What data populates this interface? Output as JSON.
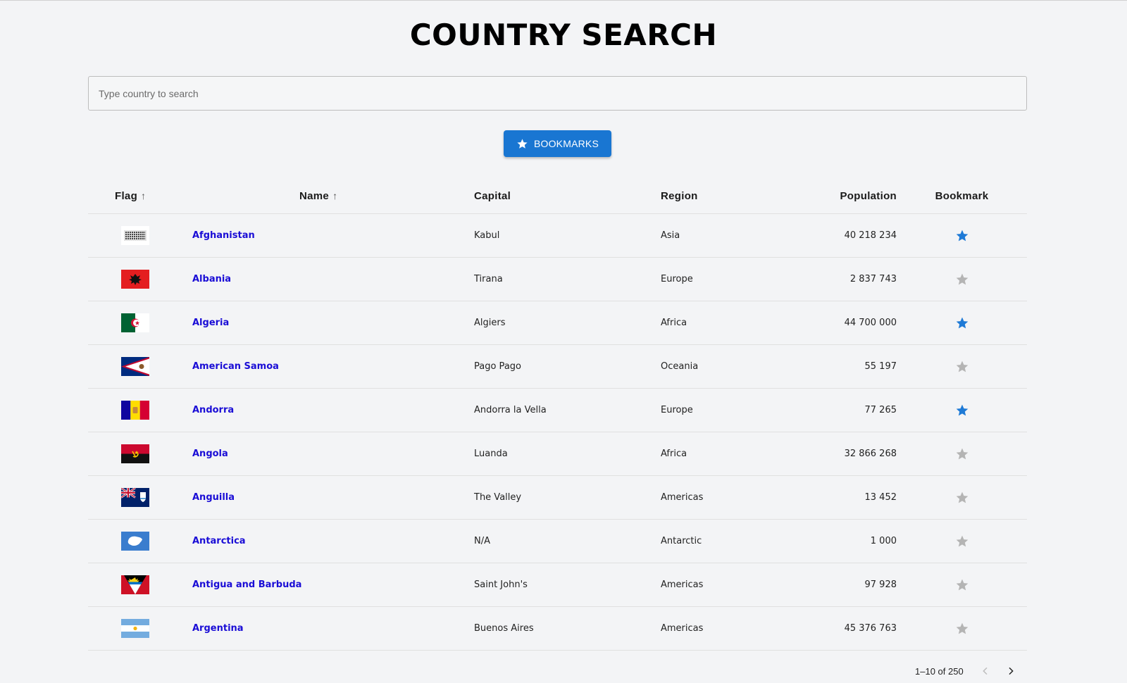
{
  "page_title": "COUNTRY SEARCH",
  "search": {
    "placeholder": "Type country to search",
    "value": ""
  },
  "bookmarks_button": {
    "label": "BOOKMARKS",
    "icon": "star-icon"
  },
  "table": {
    "columns": [
      "Flag",
      "Name",
      "Capital",
      "Region",
      "Population",
      "Bookmark"
    ],
    "sort_icons": {
      "flag": "arrow-up-icon",
      "name": "arrow-up-icon"
    },
    "rows": [
      {
        "flag": "afghanistan-flag",
        "name": "Afghanistan",
        "capital": "Kabul",
        "region": "Asia",
        "population": "40 218 234",
        "bookmarked": true
      },
      {
        "flag": "albania-flag",
        "name": "Albania",
        "capital": "Tirana",
        "region": "Europe",
        "population": "2 837 743",
        "bookmarked": false
      },
      {
        "flag": "algeria-flag",
        "name": "Algeria",
        "capital": "Algiers",
        "region": "Africa",
        "population": "44 700 000",
        "bookmarked": true
      },
      {
        "flag": "american-samoa-flag",
        "name": "American Samoa",
        "capital": "Pago Pago",
        "region": "Oceania",
        "population": "55 197",
        "bookmarked": false
      },
      {
        "flag": "andorra-flag",
        "name": "Andorra",
        "capital": "Andorra la Vella",
        "region": "Europe",
        "population": "77 265",
        "bookmarked": true
      },
      {
        "flag": "angola-flag",
        "name": "Angola",
        "capital": "Luanda",
        "region": "Africa",
        "population": "32 866 268",
        "bookmarked": false
      },
      {
        "flag": "anguilla-flag",
        "name": "Anguilla",
        "capital": "The Valley",
        "region": "Americas",
        "population": "13 452",
        "bookmarked": false
      },
      {
        "flag": "antarctica-flag",
        "name": "Antarctica",
        "capital": "N/A",
        "region": "Antarctic",
        "population": "1 000",
        "bookmarked": false
      },
      {
        "flag": "antigua-and-barbuda-flag",
        "name": "Antigua and Barbuda",
        "capital": "Saint John's",
        "region": "Americas",
        "population": "97 928",
        "bookmarked": false
      },
      {
        "flag": "argentina-flag",
        "name": "Argentina",
        "capital": "Buenos Aires",
        "region": "Americas",
        "population": "45 376 763",
        "bookmarked": false
      }
    ]
  },
  "pagination": {
    "range_text": "1–10 of 250",
    "prev_icon": "chevron-left-icon",
    "next_icon": "chevron-right-icon"
  },
  "colors": {
    "accent": "#1976d2",
    "bookmark_on": "#1e7ad6",
    "bookmark_off": "#b4b4b4",
    "link": "#1a0dd6",
    "background": "#f3f4f6"
  }
}
